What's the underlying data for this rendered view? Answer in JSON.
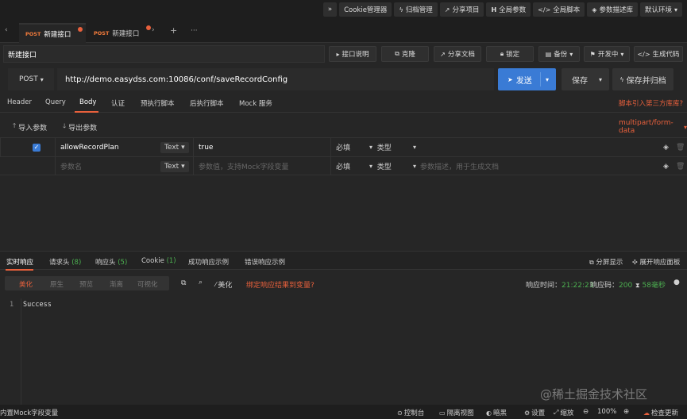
{
  "topbar": {
    "items": [
      {
        "icon": "double-chevron-right-icon",
        "label": "»"
      },
      {
        "icon": "",
        "label": "Cookie管理器"
      },
      {
        "icon": "lightning-icon",
        "label": "归档管理"
      },
      {
        "icon": "share-icon",
        "label": "分享项目"
      },
      {
        "icon": "h-icon",
        "label": "全局参数"
      },
      {
        "icon": "code-icon",
        "label": "全局脚本"
      },
      {
        "icon": "cube-icon",
        "label": "参数描述库"
      },
      {
        "icon": "chevron-down-icon",
        "label": "默认环境"
      }
    ]
  },
  "tabs": {
    "items": [
      {
        "method": "POST",
        "label": "新建接口",
        "active": true
      },
      {
        "method": "POST",
        "label": "新建接口",
        "active": false
      }
    ],
    "add": "+",
    "more": "···"
  },
  "namebar": {
    "name": "新建接口",
    "actions": [
      "接口说明",
      "克隆",
      "分享文档",
      "锁定",
      "备份",
      "开发中",
      "生成代码"
    ]
  },
  "urlbar": {
    "method": "POST",
    "url": "http://demo.easydss.com:10086/conf/saveRecordConfig",
    "send": "发送",
    "save": "保存",
    "save_archive": "保存并归档"
  },
  "subtabs": {
    "items": [
      "Header",
      "Query",
      "Body",
      "认证",
      "预执行脚本",
      "后执行脚本",
      "Mock 服务"
    ],
    "active": "Body",
    "script_link": "脚本引入第三方库库?"
  },
  "params": {
    "import": "导入参数",
    "export": "导出参数",
    "body_type": "multipart/form-data",
    "rows": [
      {
        "key": "allowRecordPlan",
        "type": "Text",
        "value": "true",
        "required": "必填",
        "vtype": "类型",
        "desc": ""
      },
      {
        "key": "参数名",
        "type": "Text",
        "value": "参数值，支持Mock字段变量",
        "required": "必填",
        "vtype": "类型",
        "desc": "参数描述，用于生成文档"
      }
    ]
  },
  "response": {
    "tabs": [
      {
        "label": "实时响应",
        "count": ""
      },
      {
        "label": "请求头",
        "count": "(8)"
      },
      {
        "label": "响应头",
        "count": "(5)"
      },
      {
        "label": "Cookie",
        "count": "(1)"
      },
      {
        "label": "成功响应示例",
        "count": ""
      },
      {
        "label": "错误响应示例",
        "count": ""
      }
    ],
    "split": "分屏显示",
    "expand": "展开响应面板",
    "modes": [
      "美化",
      "原生",
      "预览",
      "渐离",
      "可视化"
    ],
    "beautify": "美化",
    "bind_link": "绑定响应结果到变量?",
    "time_label": "响应时间：",
    "time": "21:22:23",
    "code_label": "响应码：",
    "code": "200",
    "ms": "58毫秒",
    "lines": [
      {
        "no": "1",
        "text": "Success"
      }
    ]
  },
  "statusbar": {
    "mock": "内置Mock字段变量",
    "console": "控制台",
    "view": "隔离视图",
    "theme": "暗黑",
    "settings": "设置",
    "zoom_label": "缩放",
    "zoom": "100%",
    "update": "检查更新"
  },
  "watermark": "@稀土掘金技术社区"
}
